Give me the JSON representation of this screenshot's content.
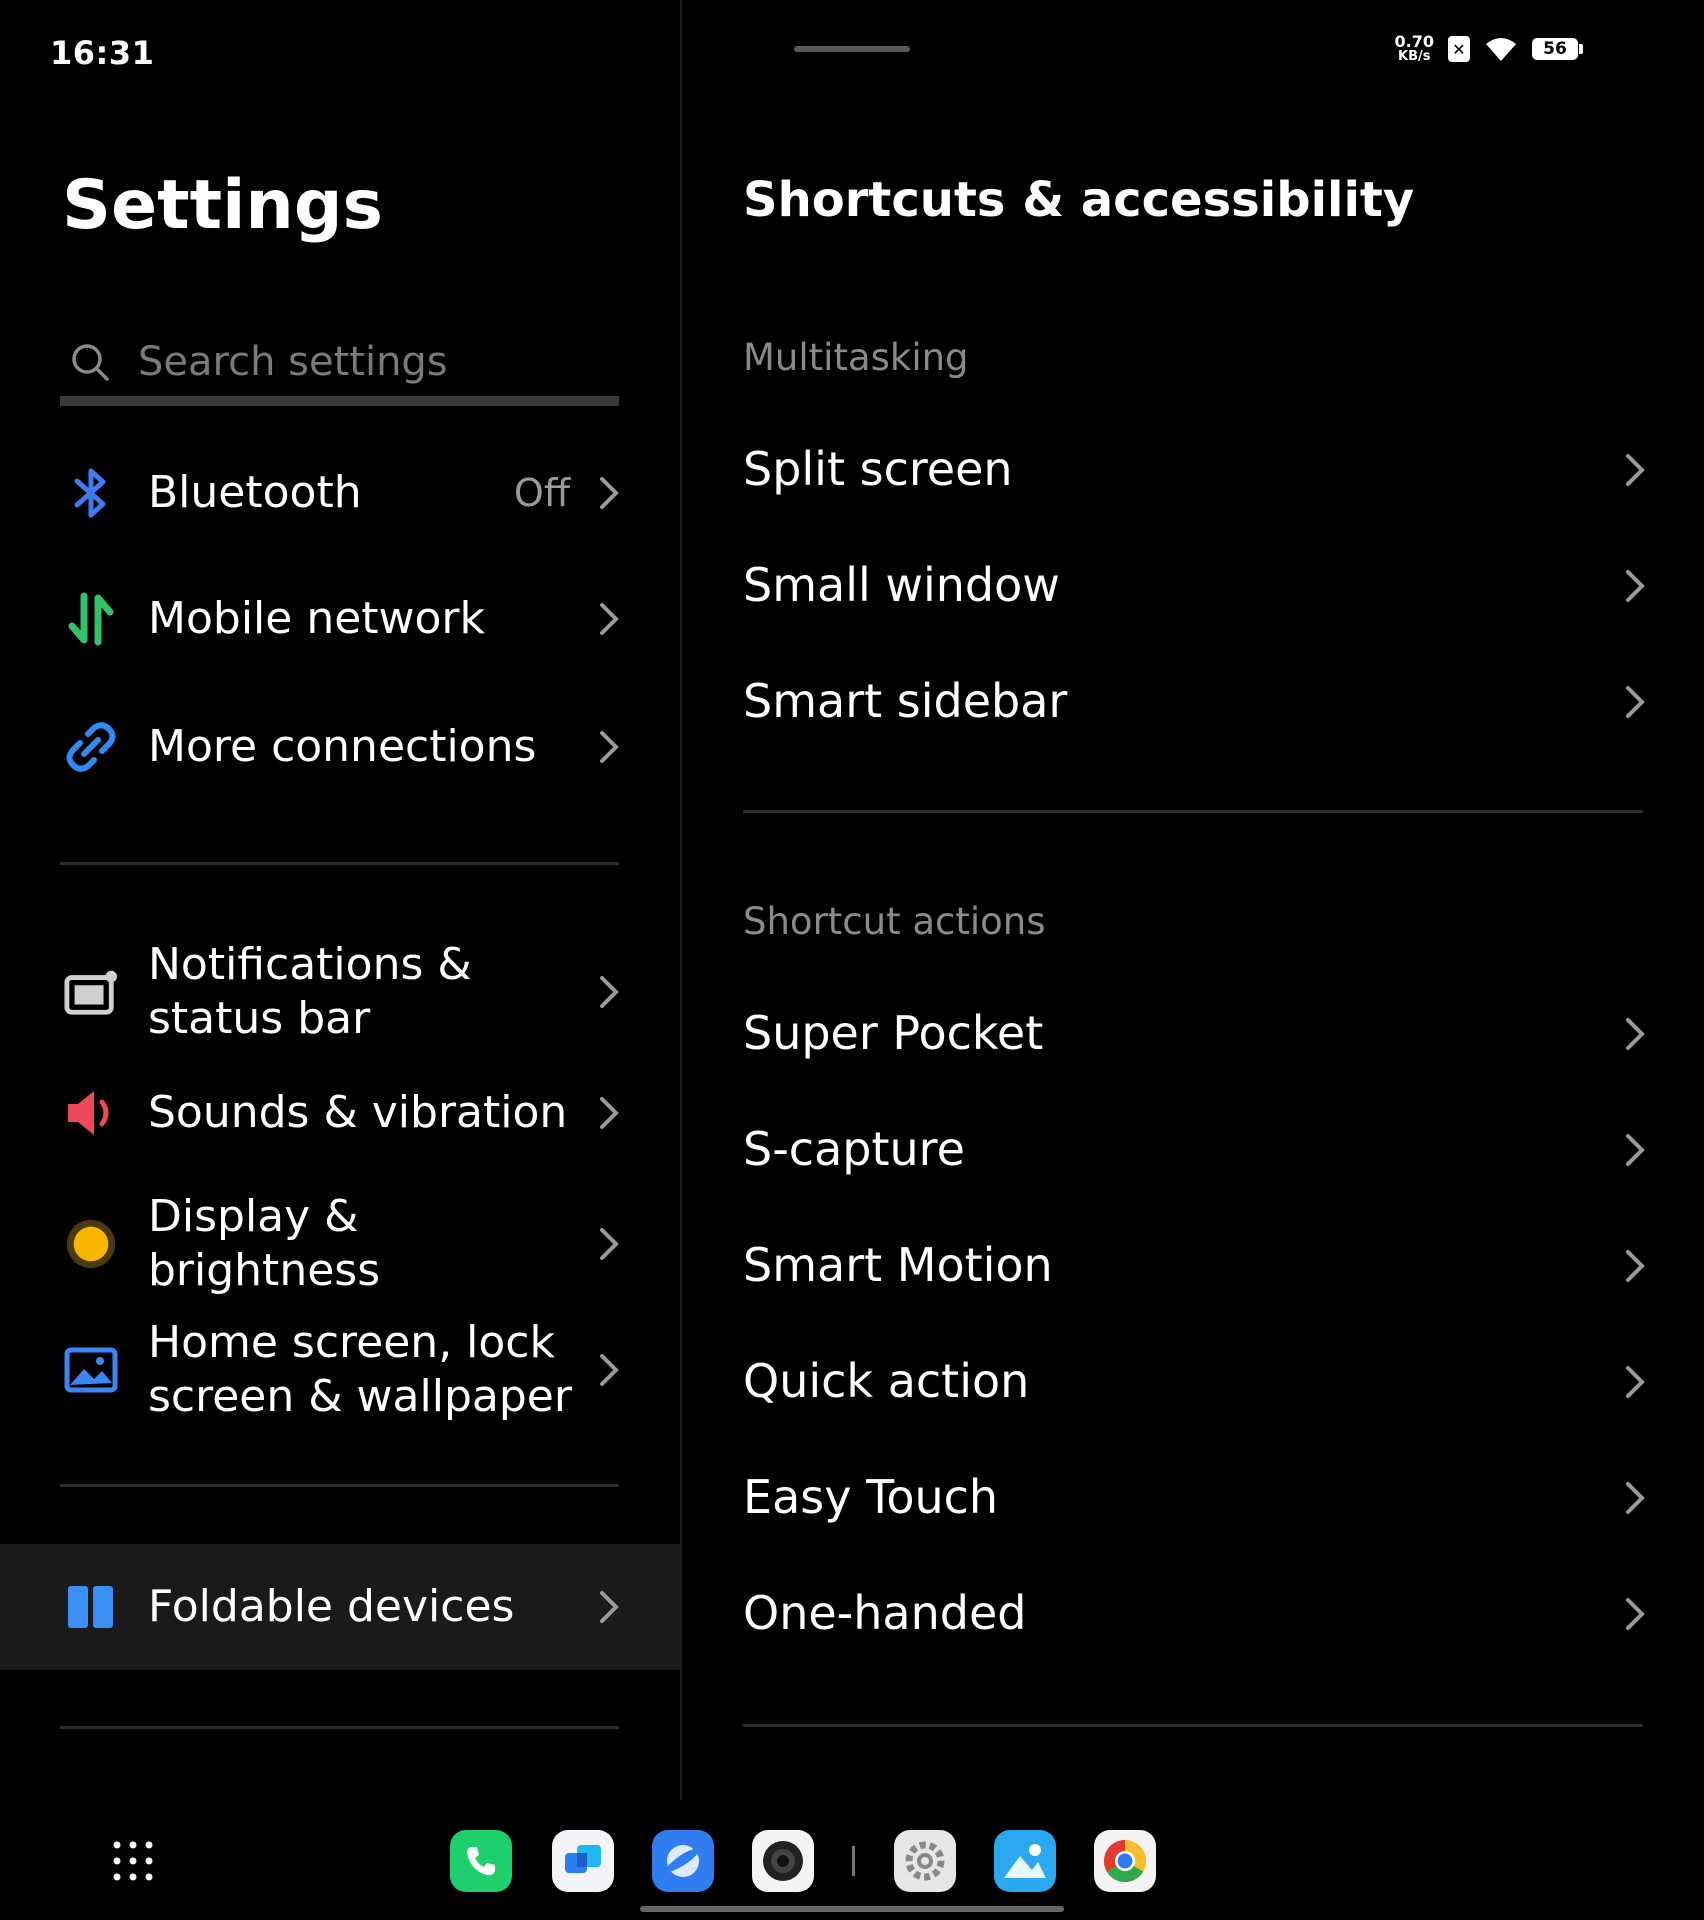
{
  "status_bar": {
    "time": "16:31",
    "net_speed": "0.70",
    "net_unit": "KB/s",
    "battery": "56"
  },
  "left": {
    "title": "Settings",
    "search_placeholder": "Search settings",
    "items": [
      {
        "label": "Bluetooth",
        "value": "Off",
        "icon": "bluetooth-icon",
        "color": "#3f7cf2"
      },
      {
        "label": "Mobile network",
        "icon": "mobile-network-icon",
        "color": "#33c26a"
      },
      {
        "label": "More connections",
        "icon": "link-icon",
        "color": "#2f8cf5"
      },
      {
        "label": "Notifications &\nstatus bar",
        "icon": "notification-icon",
        "color": "#d0d0d0"
      },
      {
        "label": "Sounds & vibration",
        "icon": "speaker-icon",
        "color": "#f0475a"
      },
      {
        "label": "Display &\nbrightness",
        "icon": "brightness-icon",
        "color": "#f7b500"
      },
      {
        "label": "Home screen, lock\nscreen & wallpaper",
        "icon": "wallpaper-icon",
        "color": "#3a86f5"
      },
      {
        "label": "Foldable devices",
        "icon": "foldable-icon",
        "color": "#3a8ef5",
        "selected": true
      }
    ]
  },
  "right": {
    "title": "Shortcuts & accessibility",
    "sections": [
      {
        "header": "Multitasking",
        "items": [
          "Split screen",
          "Small window",
          "Smart sidebar"
        ]
      },
      {
        "header": "Shortcut actions",
        "items": [
          "Super Pocket",
          "S-capture",
          "Smart Motion",
          "Quick action",
          "Easy Touch",
          "One-handed"
        ]
      }
    ]
  },
  "dock": {
    "apps": [
      "phone-app-icon",
      "messages-app-icon",
      "browser-app-icon",
      "camera-app-icon",
      "settings-app-icon",
      "gallery-app-icon",
      "chrome-app-icon"
    ]
  }
}
